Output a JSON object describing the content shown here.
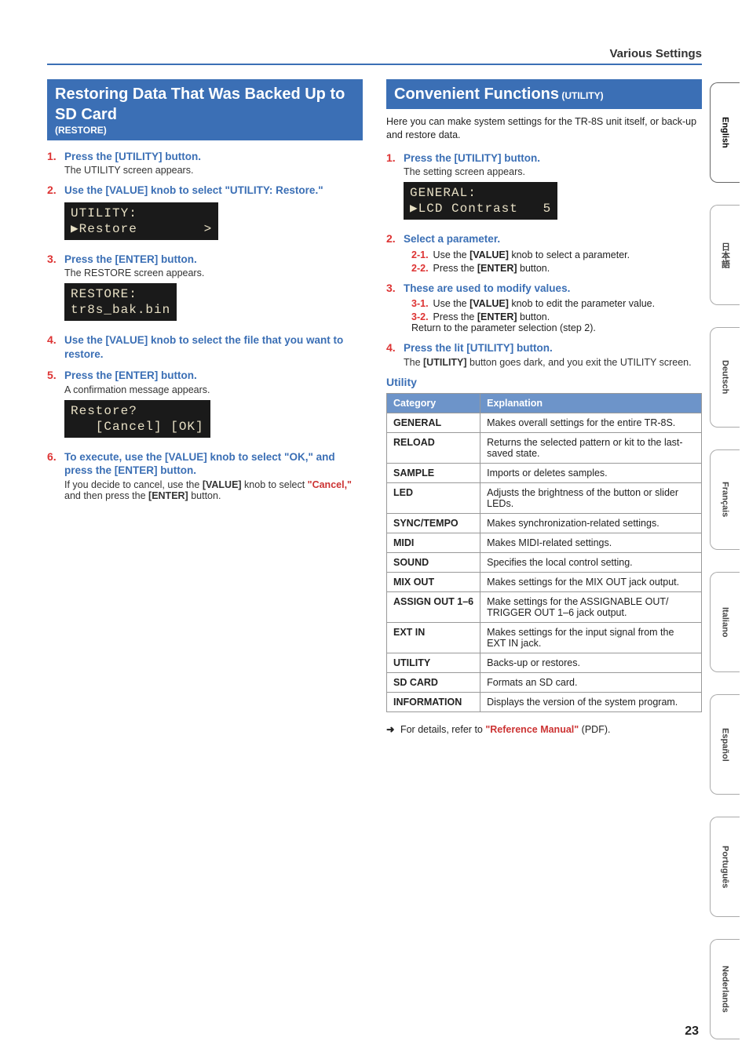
{
  "header": {
    "section": "Various Settings"
  },
  "left": {
    "title_big": "Restoring Data That Was Backed Up to SD Card",
    "title_small": "(RESTORE)",
    "steps": [
      {
        "num": "1.",
        "head": "Press the [UTILITY] button.",
        "sub": "The UTILITY screen appears."
      },
      {
        "num": "2.",
        "head": "Use the [VALUE] knob to select \"UTILITY: Restore.\"",
        "lcd": "UTILITY:\n▶Restore        >"
      },
      {
        "num": "3.",
        "head": "Press the [ENTER] button.",
        "sub": "The RESTORE screen appears.",
        "lcd": "RESTORE:\ntr8s_bak.bin"
      },
      {
        "num": "4.",
        "head": "Use the [VALUE] knob to select the file that you want to restore."
      },
      {
        "num": "5.",
        "head": "Press the [ENTER] button.",
        "sub": "A confirmation message appears.",
        "lcd": "Restore?\n   [Cancel] [OK]"
      },
      {
        "num": "6.",
        "head": "To execute, use the [VALUE] knob to select \"OK,\" and press the [ENTER] button.",
        "sub_html": "If you decide to cancel, use the <span class='bold'>[VALUE]</span> knob to select <span class='red'>\"Cancel,\"</span> and then press the <span class='bold'>[ENTER]</span> button."
      }
    ]
  },
  "right": {
    "title_big": "Convenient Functions",
    "title_small": " (UTILITY)",
    "intro": "Here you can make system settings for the TR-8S unit itself, or back-up and restore data.",
    "steps": [
      {
        "num": "1.",
        "head": "Press the [UTILITY] button.",
        "sub": "The setting screen appears.",
        "lcd": "GENERAL:\n▶LCD Contrast   5"
      },
      {
        "num": "2.",
        "head": "Select a parameter.",
        "subs": [
          {
            "snum": "2-1.",
            "text_html": "Use the <span class='bold'>[VALUE]</span> knob to select a parameter."
          },
          {
            "snum": "2-2.",
            "text_html": "Press the <span class='bold'>[ENTER]</span> button."
          }
        ]
      },
      {
        "num": "3.",
        "head": "These are used to modify values.",
        "subs": [
          {
            "snum": "3-1.",
            "text_html": "Use the <span class='bold'>[VALUE]</span> knob to edit the parameter value."
          },
          {
            "snum": "3-2.",
            "text_html": "Press the <span class='bold'>[ENTER]</span> button.<br>Return to the parameter selection (step 2)."
          }
        ]
      },
      {
        "num": "4.",
        "head": "Press the lit [UTILITY] button.",
        "sub_html": "The <span class='bold'>[UTILITY]</span> button goes dark, and you exit the UTILITY screen."
      }
    ],
    "utility_label": "Utility",
    "table": {
      "headers": [
        "Category",
        "Explanation"
      ],
      "rows": [
        [
          "GENERAL",
          "Makes overall settings for the entire TR-8S."
        ],
        [
          "RELOAD",
          "Returns the selected pattern or kit to the last-saved state."
        ],
        [
          "SAMPLE",
          "Imports or deletes samples."
        ],
        [
          "LED",
          "Adjusts the brightness of the button or slider LEDs."
        ],
        [
          "SYNC/TEMPO",
          "Makes synchronization-related settings."
        ],
        [
          "MIDI",
          "Makes MIDI-related settings."
        ],
        [
          "SOUND",
          "Specifies the local control setting."
        ],
        [
          "MIX OUT",
          "Makes settings for the MIX OUT jack output."
        ],
        [
          "ASSIGN OUT 1–6",
          "Make settings for the ASSIGNABLE OUT/ TRIGGER OUT 1–6 jack output."
        ],
        [
          "EXT IN",
          "Makes settings for the input signal from the EXT IN jack."
        ],
        [
          "UTILITY",
          "Backs-up or restores."
        ],
        [
          "SD CARD",
          "Formats an SD card."
        ],
        [
          "INFORMATION",
          "Displays the version of the system program."
        ]
      ]
    },
    "footnote_pre": "For details, refer to ",
    "footnote_ref": "\"Reference Manual\"",
    "footnote_post": " (PDF)."
  },
  "languages": [
    "English",
    "日本語",
    "Deutsch",
    "Français",
    "Italiano",
    "Español",
    "Português",
    "Nederlands"
  ],
  "page": "23"
}
